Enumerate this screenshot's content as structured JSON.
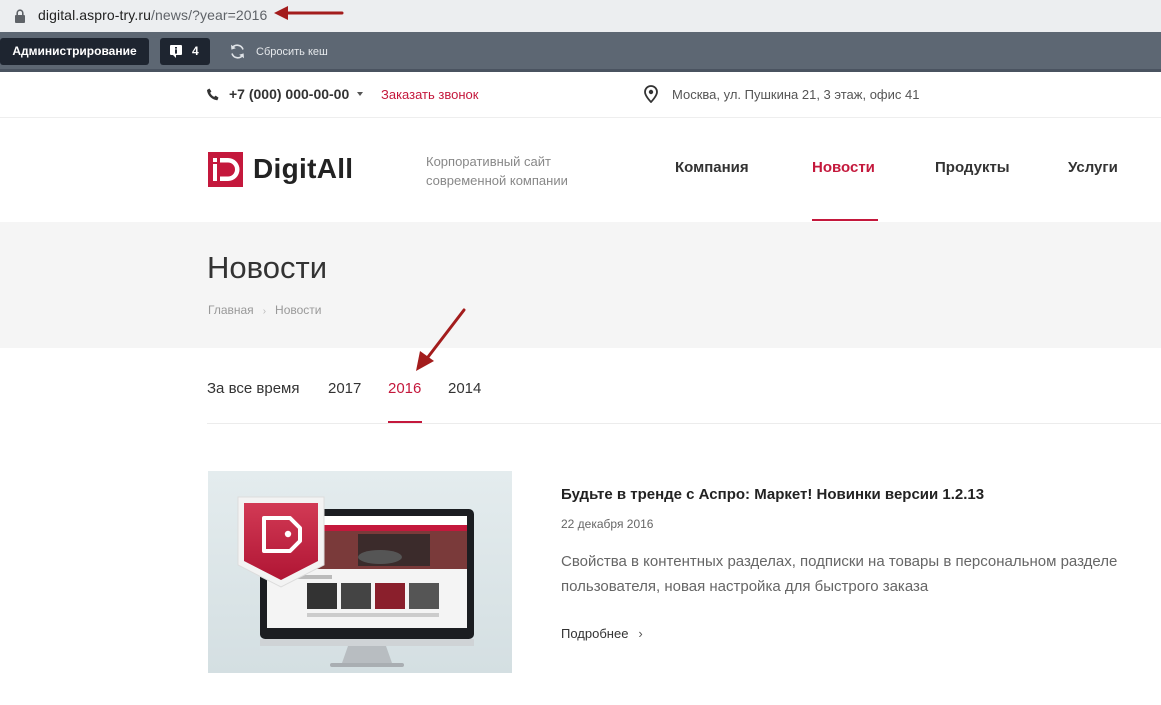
{
  "browser": {
    "url_host": "digital.aspro-try.ru",
    "url_path": "/news/?year=2016"
  },
  "admin_panel": {
    "admin_label": "Администрирование",
    "info_count": "4",
    "clear_cache_label": "Сбросить кеш"
  },
  "topbar": {
    "phone": "+7 (000) 000-00-00",
    "callback": "Заказать звонок",
    "address": "Москва, ул. Пушкина 21, 3 этаж, офис 41"
  },
  "header": {
    "logo_text": "DigitAll",
    "slogan": "Корпоративный сайт современной компании",
    "nav": [
      {
        "label": "Компания"
      },
      {
        "label": "Новости"
      },
      {
        "label": "Продукты"
      },
      {
        "label": "Услуги"
      }
    ],
    "active_nav": "Новости"
  },
  "page": {
    "title": "Новости",
    "breadcrumbs": [
      "Главная",
      "Новости"
    ]
  },
  "year_filter": {
    "items": [
      "За все время",
      "2017",
      "2016",
      "2014"
    ],
    "active": "2016"
  },
  "news": [
    {
      "title": "Будьте в тренде с Аспро: Маркет! Новинки версии 1.2.13",
      "date": "22 декабря 2016",
      "text": "Свойства в контентных разделах, подписки на товары в персональном разделе пользователя, новая настройка для быстрого заказа",
      "more": "Подробнее"
    }
  ],
  "colors": {
    "accent": "#c4183c",
    "admin_bar": "#5d6773",
    "admin_button": "#1e2530",
    "title_band": "#f5f5f5",
    "annotation_arrow": "#a31c1c"
  }
}
